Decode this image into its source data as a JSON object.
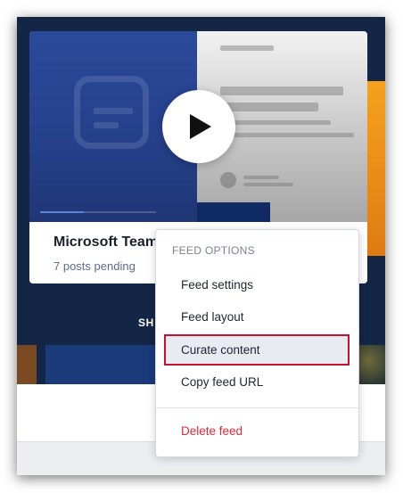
{
  "card": {
    "title": "Microsoft Team",
    "subtitle": "7 posts pending",
    "video_progress_fraction": 0.38
  },
  "band": {
    "partial_text": "SH"
  },
  "menu": {
    "header": "FEED OPTIONS",
    "items": [
      {
        "label": "Feed settings"
      },
      {
        "label": "Feed layout"
      },
      {
        "label": "Curate content",
        "highlighted": true
      },
      {
        "label": "Copy feed URL"
      },
      {
        "label": "Delete feed",
        "danger": true
      }
    ]
  },
  "colors": {
    "band_navy": "#132645",
    "danger_red": "#e0283a",
    "highlight_border": "#c8102e"
  },
  "icons": {
    "play": "play-icon",
    "logo": "app-logo-icon"
  }
}
